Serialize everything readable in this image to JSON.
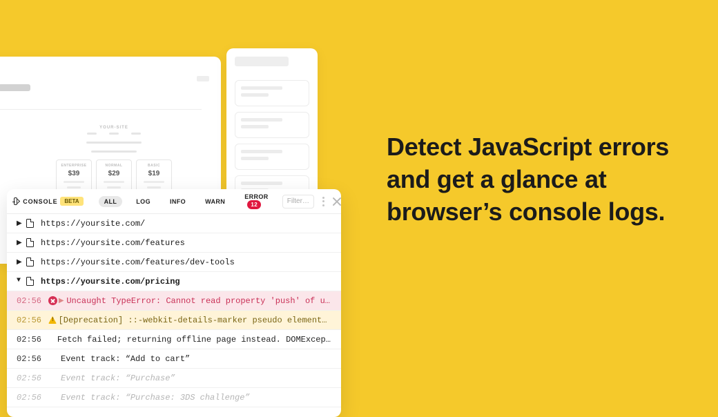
{
  "headline": "Detect JavaScript errors and get a glance at browser’s console logs.",
  "pricing_preview": {
    "site_label": "YOUR-SITE",
    "plans": [
      {
        "tier": "ENTERPRISE",
        "price": "$39"
      },
      {
        "tier": "NORMAL",
        "price": "$29"
      },
      {
        "tier": "BASIC",
        "price": "$19"
      }
    ]
  },
  "console": {
    "title": "CONSOLE",
    "beta_tag": "BETA",
    "tabs": {
      "all": "ALL",
      "log": "LOG",
      "info": "INFO",
      "warn": "WARN",
      "error": "ERROR",
      "error_count": "12",
      "active": "all"
    },
    "filter_placeholder": "Filter…",
    "groups": [
      {
        "url": "https://yoursite.com/",
        "expanded": false
      },
      {
        "url": "https://yoursite.com/features",
        "expanded": false
      },
      {
        "url": "https://yoursite.com/features/dev-tools",
        "expanded": false
      },
      {
        "url": "https://yoursite.com/pricing",
        "expanded": true
      }
    ],
    "logs": [
      {
        "level": "error",
        "time": "02:56",
        "msg": "Uncaught TypeError: Cannot read property 'push' of unde…",
        "expandable": true
      },
      {
        "level": "warn",
        "time": "02:56",
        "msg": "[Deprecation] ::-webkit-details-marker pseudo element sel…"
      },
      {
        "level": "log",
        "time": "02:56",
        "msg": "Fetch failed; returning offline page instead. DOMException:…"
      },
      {
        "level": "log",
        "time": "02:56",
        "msg": "Event track: “Add to cart”"
      },
      {
        "level": "log",
        "time": "02:56",
        "msg": "Event track: “Purchase”",
        "faded": true
      },
      {
        "level": "log",
        "time": "02:56",
        "msg": "Event track: “Purchase: 3DS challenge”",
        "faded": true
      }
    ]
  }
}
